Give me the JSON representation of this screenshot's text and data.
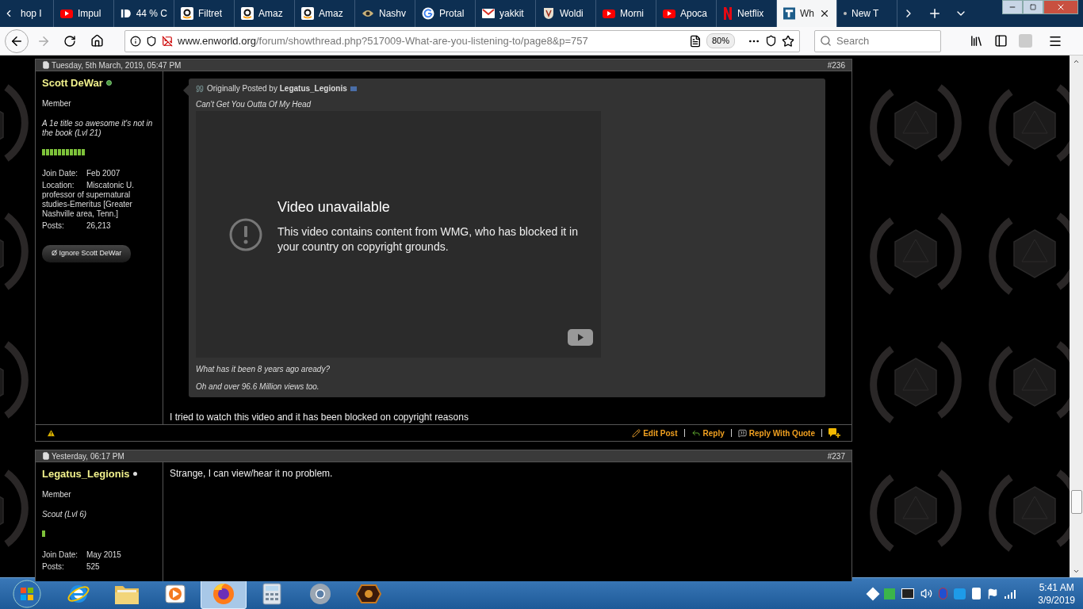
{
  "browser": {
    "tabs": [
      {
        "title": "hop I",
        "kind": "none",
        "selected": false
      },
      {
        "title": "Impul",
        "kind": "play",
        "selected": false
      },
      {
        "title": "44 % C",
        "kind": "id",
        "selected": false
      },
      {
        "title": "Filtret",
        "kind": "a",
        "selected": false
      },
      {
        "title": "Amaz",
        "kind": "a",
        "selected": false
      },
      {
        "title": "Amaz",
        "kind": "a",
        "selected": false
      },
      {
        "title": "Nashv",
        "kind": "eye",
        "selected": false
      },
      {
        "title": "Protal",
        "kind": "g",
        "selected": false
      },
      {
        "title": "yakkit",
        "kind": "mail",
        "selected": false
      },
      {
        "title": "Woldi",
        "kind": "shield",
        "selected": false
      },
      {
        "title": "Morni",
        "kind": "play",
        "selected": false
      },
      {
        "title": "Apoca",
        "kind": "play",
        "selected": false
      },
      {
        "title": "Netflix",
        "kind": "n",
        "selected": false
      },
      {
        "title": "Wh",
        "kind": "page",
        "selected": true
      },
      {
        "title": "New T",
        "kind": "dot",
        "selected": false
      }
    ],
    "address": {
      "host": "www.enworld.org",
      "path": "/forum/showthread.php?517009-What-are-you-listening-to/page8&p=757"
    },
    "zoom": "80%",
    "search": {
      "placeholder": "Search"
    }
  },
  "posts": [
    {
      "date": "Tuesday, 5th March, 2019, 05:47 PM",
      "number": "#236",
      "user": "Scott DeWar",
      "online": true,
      "rank": "Member",
      "title": "A 1e title so awesome it's not in the book (Lvl 21)",
      "reputation": [
        {
          "kind": "pip"
        },
        {
          "kind": "pip"
        },
        {
          "kind": "pip"
        },
        {
          "kind": "pip"
        },
        {
          "kind": "pip"
        },
        {
          "kind": "pip"
        },
        {
          "kind": "pip"
        },
        {
          "kind": "pip"
        },
        {
          "kind": "pip"
        },
        {
          "kind": "pip"
        },
        {
          "kind": "pip"
        }
      ],
      "info": [
        {
          "label": "Join Date:",
          "value": "Feb 2007"
        },
        {
          "label": "Location:",
          "value": "Miscatonic U. professor of supernatural studies-Emeritus [Greater Nashville area, Tenn.]"
        },
        {
          "label": "Posts:",
          "value": "26,213"
        }
      ],
      "ignore_button": "Ø Ignore Scott DeWar",
      "quote": {
        "prefix": "Originally Posted by",
        "author": "Legatus_Legionis",
        "lines_before": [
          "Can't Get You Outta Of My Head"
        ],
        "video": {
          "title": "Video unavailable",
          "message": "This video contains content from WMG, who has blocked it in your country on copyright grounds."
        },
        "lines_after": [
          "What has it been 8 years ago aready?",
          "Oh and over 96.6 Million views too."
        ]
      },
      "body": "I tried to watch this video and it has been blocked on copyright reasons",
      "actions": [
        {
          "label": "Edit Post",
          "kind": "edit"
        },
        {
          "label": "Reply",
          "kind": "reply"
        },
        {
          "label": "Reply With Quote",
          "kind": "quote"
        },
        {
          "kind": "multiquote"
        }
      ]
    },
    {
      "date": "Yesterday, 06:17 PM",
      "number": "#237",
      "user": "Legatus_Legionis",
      "online": false,
      "rank": "Member",
      "title": "Scout (Lvl 6)",
      "reputation": [
        {
          "kind": "pip"
        }
      ],
      "info": [
        {
          "label": "Join Date:",
          "value": "May 2015"
        },
        {
          "label": "Posts:",
          "value": "525"
        }
      ],
      "body": "Strange, I can view/hear it no problem."
    }
  ],
  "taskbar": {
    "apps": [
      {
        "kind": "ie",
        "selected": false
      },
      {
        "kind": "folder",
        "selected": false
      },
      {
        "kind": "media",
        "selected": false
      },
      {
        "kind": "firefox",
        "selected": true
      },
      {
        "kind": "calculator",
        "selected": false
      },
      {
        "kind": "chrome",
        "selected": false
      },
      {
        "kind": "game",
        "selected": false
      }
    ],
    "time": "5:41 AM",
    "date": "3/9/2019"
  }
}
